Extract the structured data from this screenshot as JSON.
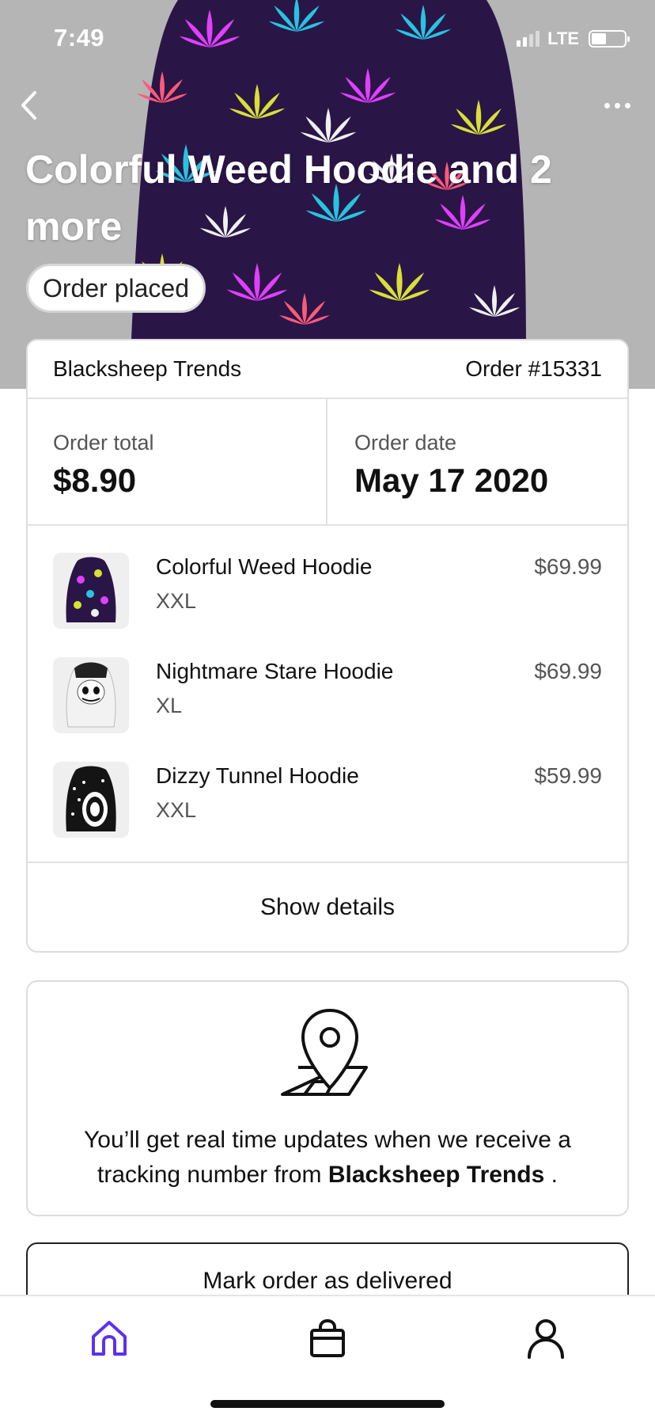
{
  "status_bar": {
    "time": "7:49",
    "network": "LTE"
  },
  "header": {
    "title": "Colorful Weed Hoodie and 2 more",
    "status": "Order placed"
  },
  "order": {
    "store": "Blacksheep Trends",
    "number": "Order #15331",
    "total_label": "Order total",
    "total": "$8.90",
    "date_label": "Order date",
    "date": "May 17 2020",
    "items": [
      {
        "name": "Colorful Weed Hoodie",
        "size": "XXL",
        "price": "$69.99",
        "thumb": "weed-hoodie"
      },
      {
        "name": "Nightmare Stare Hoodie",
        "size": "XL",
        "price": "$69.99",
        "thumb": "skull-hoodie"
      },
      {
        "name": "Dizzy Tunnel Hoodie",
        "size": "XXL",
        "price": "$59.99",
        "thumb": "tunnel-hoodie"
      }
    ],
    "show_details": "Show details"
  },
  "tracking": {
    "text_before": "You’ll get real time updates when we receive a tracking number from",
    "store": "Blacksheep Trends",
    "text_after": " .",
    "icon": "map-pin-icon"
  },
  "actions": {
    "mark_delivered": "Mark order as delivered"
  },
  "bottom_nav": {
    "items": [
      "home-icon",
      "shopping-bag-icon",
      "profile-icon"
    ],
    "active": "home",
    "active_color": "#5a31f4"
  }
}
